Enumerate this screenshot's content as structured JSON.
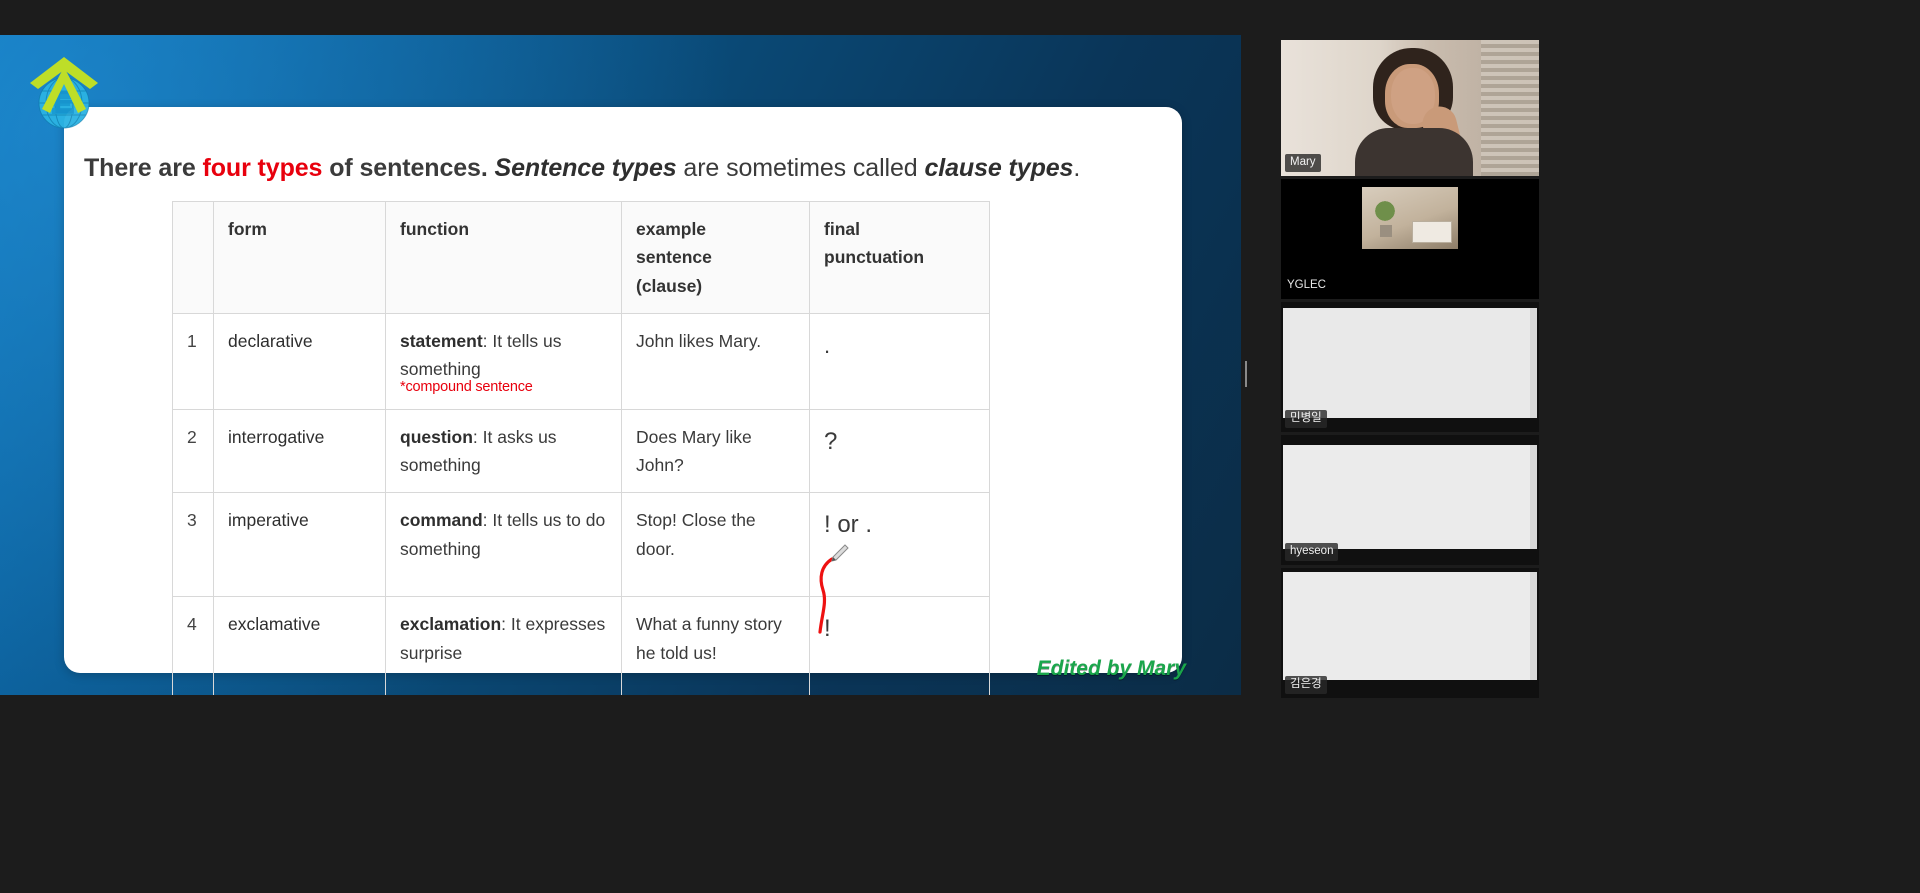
{
  "window": {
    "background_color": "#1c1c1c",
    "stage_gradient_from": "#0d73b8",
    "stage_gradient_to": "#0b2c46"
  },
  "logo": {
    "name": "yglec-arrow-globe-logo",
    "arrow_color": "#bede28",
    "globe_color": "#2bb3e3",
    "letter": "E"
  },
  "slide": {
    "heading": {
      "part1": "There are ",
      "accent": "four types",
      "part2": " of sentences. ",
      "italic1": "Sentence types",
      "part3": " are sometimes called ",
      "italic2": "clause types",
      "part4": "."
    },
    "credit": "Edited by Mary",
    "credit_color": "#1aa64b",
    "annotation_color": "#e8000d"
  },
  "table": {
    "headers": [
      "",
      "form",
      "function",
      "example sentence (clause)",
      "final punctuation"
    ],
    "header_cells": {
      "num": "",
      "form": "form",
      "function": "function",
      "example_line1": "example",
      "example_line2": "sentence",
      "example_line3": "(clause)",
      "punctuation_line1": "final",
      "punctuation_line2": "punctuation"
    },
    "rows": [
      {
        "num": "1",
        "form": "declarative",
        "function_bold": "statement",
        "function_rest": ": It tells us something",
        "function_note": "*compound sentence",
        "example": "John likes Mary.",
        "punctuation": "."
      },
      {
        "num": "2",
        "form": "interrogative",
        "function_bold": "question",
        "function_rest": ": It asks us something",
        "function_note": "",
        "example": "Does Mary like John?",
        "punctuation": "?"
      },
      {
        "num": "3",
        "form": "imperative",
        "function_bold": "command",
        "function_rest": ": It tells us to do something",
        "function_note": "",
        "example": "Stop! Close the door.",
        "punctuation": "! or ."
      },
      {
        "num": "4",
        "form": "exclamative",
        "function_bold": "exclamation",
        "function_rest": ": It expresses surprise",
        "function_note": "",
        "example": "What a funny story he told us!",
        "punctuation": "!"
      }
    ]
  },
  "filmstrip": {
    "participants": [
      {
        "name": "Mary",
        "active_speaker": true
      },
      {
        "name": "YGLEC",
        "active_speaker": false
      },
      {
        "name": "민병일",
        "active_speaker": false
      },
      {
        "name": "hyeseon",
        "active_speaker": false
      },
      {
        "name": "김은경",
        "active_speaker": false
      }
    ],
    "active_border_color": "#b8e03a"
  },
  "controls": {
    "drag_handle": "share-resize-handle"
  }
}
